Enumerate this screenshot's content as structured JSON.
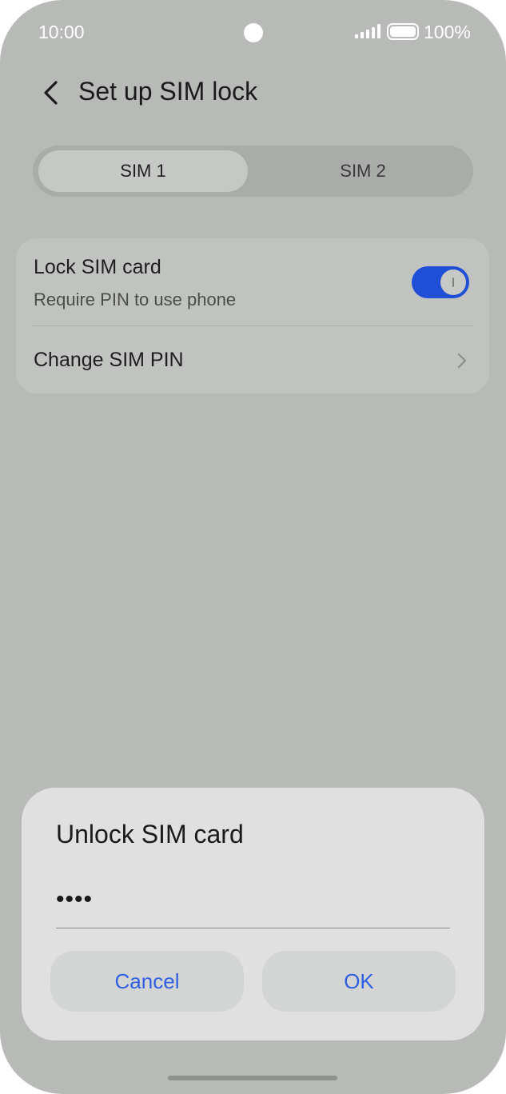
{
  "status_bar": {
    "time": "10:00",
    "battery": "100%",
    "icons": [
      "camera-cutout",
      "signal-icon",
      "battery-icon"
    ]
  },
  "header": {
    "title": "Set up SIM lock",
    "back_icon": "chevron-left-icon"
  },
  "tabs": [
    {
      "label": "SIM 1",
      "selected": true
    },
    {
      "label": "SIM 2",
      "selected": false
    }
  ],
  "settings": {
    "lock_sim": {
      "title": "Lock SIM card",
      "subtitle": "Require PIN to use phone",
      "enabled": true
    },
    "change_pin": {
      "title": "Change SIM PIN",
      "icon": "chevron-right-icon"
    }
  },
  "dialog": {
    "title": "Unlock SIM card",
    "pin_value": "••••",
    "cancel_label": "Cancel",
    "ok_label": "OK"
  },
  "colors": {
    "accent": "#1f4fd6",
    "button_text": "#2f5fe0",
    "scrim_background": "#b8bab7"
  }
}
